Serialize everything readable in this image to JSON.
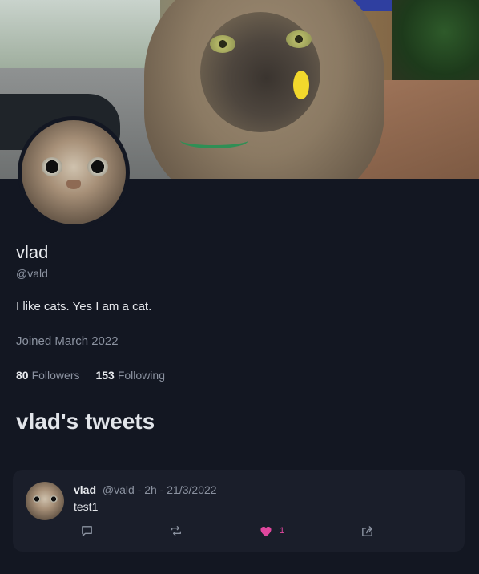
{
  "profile": {
    "name": "vlad",
    "handle": "@vald",
    "bio": "I like cats. Yes I am a cat.",
    "joined": "Joined March 2022",
    "followers_count": "80",
    "followers_label": "Followers",
    "following_count": "153",
    "following_label": "Following"
  },
  "tweets_section": {
    "title": "vlad's tweets"
  },
  "tweets": [
    {
      "author_name": "vlad",
      "author_handle": "@vald",
      "meta": "- 2h - 21/3/2022",
      "text": "test1",
      "likes": "1"
    }
  ],
  "icons": {
    "reply": "comment-icon",
    "retweet": "retweet-icon",
    "like": "heart-icon",
    "share": "share-icon"
  },
  "colors": {
    "background": "#131722",
    "card": "#1a1e2a",
    "muted_text": "#8b92a0",
    "like_accent": "#e0479e"
  }
}
